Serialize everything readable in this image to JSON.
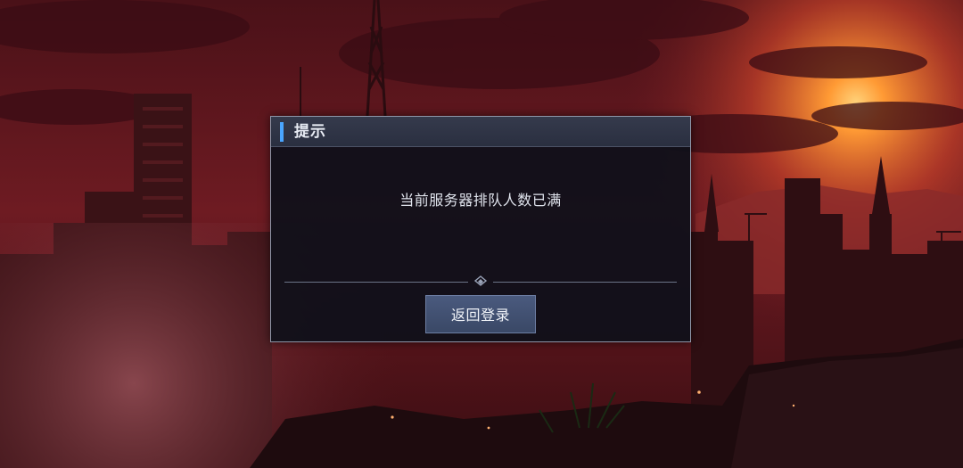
{
  "dialog": {
    "title": "提示",
    "message": "当前服务器排队人数已满",
    "button_label": "返回登录"
  },
  "colors": {
    "accent": "#4aa6ff",
    "button": "#44537a",
    "dialog_bg": "#0e101a",
    "header_bg": "#2f3446",
    "sky": "#7a1e24",
    "sun_glow": "#ff8a2a"
  },
  "icons": {
    "divider_ornament": "diamond-chevron-icon"
  }
}
